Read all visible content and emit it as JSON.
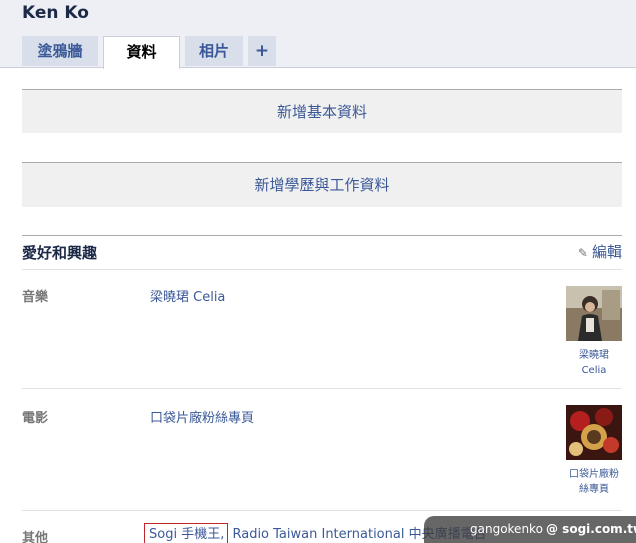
{
  "profile": {
    "name": "Ken Ko"
  },
  "tabs": [
    {
      "label": "塗鴉牆"
    },
    {
      "label": "資料"
    },
    {
      "label": "相片"
    },
    {
      "label": "+"
    }
  ],
  "sections": {
    "basic_info_label": "新增基本資料",
    "education_work_label": "新增學歷與工作資料"
  },
  "interests": {
    "title": "愛好和興趣",
    "edit_label": "編輯",
    "music": {
      "label": "音樂",
      "value": "梁曉珺 Celia",
      "thumb_caption_line1": "梁曉珺",
      "thumb_caption_line2": "Celia"
    },
    "movies": {
      "label": "電影",
      "value": "口袋片廠粉絲專頁",
      "thumb_caption_line1": "口袋片廠粉",
      "thumb_caption_line2": "絲專頁"
    },
    "other": {
      "label": "其他",
      "value_highlighted": "Sogi 手機王,",
      "value_rest": "Radio Taiwan International 中央廣播電台"
    }
  },
  "watermark": {
    "user": "gangokenko",
    "site": "@ sogi.com.tw"
  }
}
